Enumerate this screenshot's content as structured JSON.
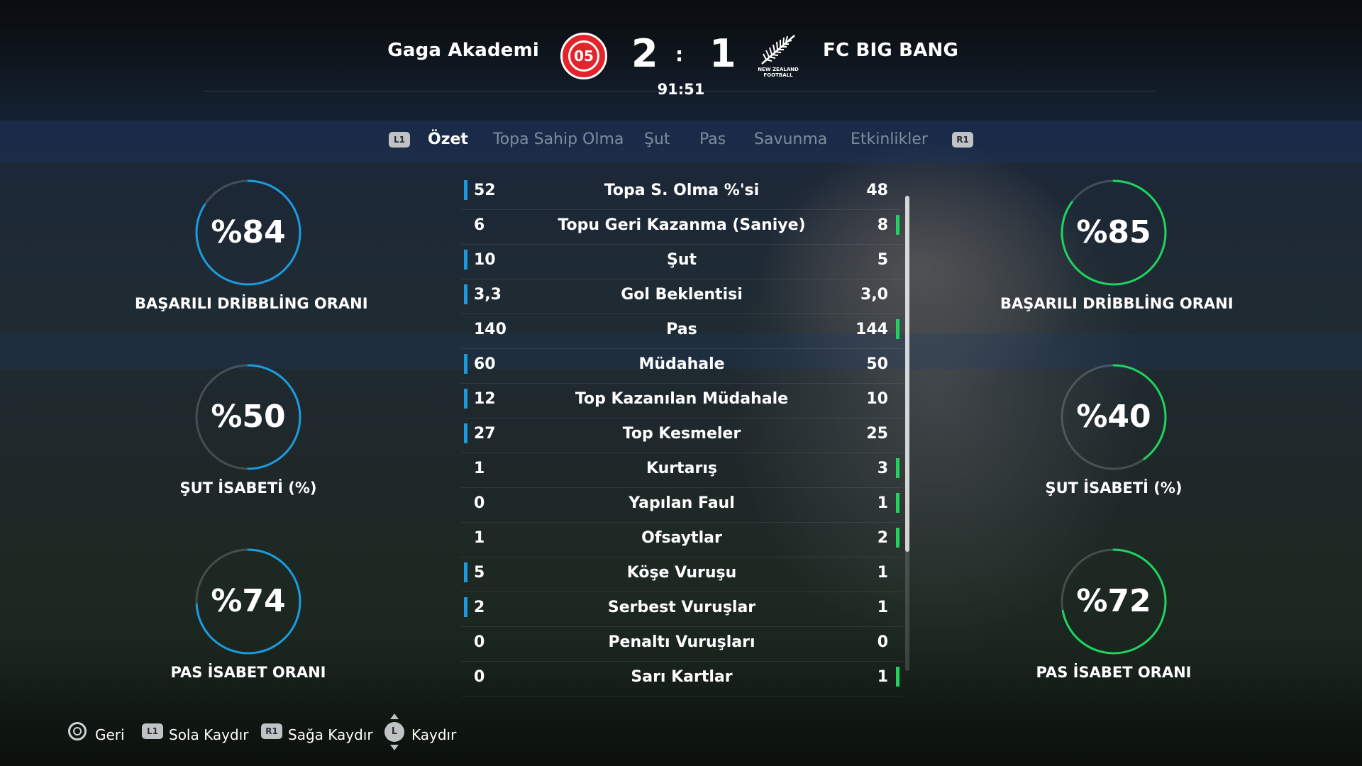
{
  "match": {
    "home_team": "Gaga Akademi",
    "away_team": "FC BIG BANG",
    "home_score": "2",
    "away_score": "1",
    "score_separator": ":",
    "clock": "91:51",
    "home_crest_text": "05",
    "away_crest_caption": "NEW ZEALAND FOOTBALL"
  },
  "tabs": {
    "left_button": "L1",
    "right_button": "R1",
    "items": [
      "Özet",
      "Topa Sahip Olma",
      "Şut",
      "Pas",
      "Savunma",
      "Etkinlikler"
    ],
    "active_index": 0
  },
  "home_rings": [
    {
      "value": "%84",
      "label": "BAŞARILI DRİBBLİNG ORANI",
      "fraction": 0.84
    },
    {
      "value": "%50",
      "label": "ŞUT İSABETİ (%)",
      "fraction": 0.5
    },
    {
      "value": "%74",
      "label": "PAS İSABET ORANI",
      "fraction": 0.74
    }
  ],
  "away_rings": [
    {
      "value": "%85",
      "label": "BAŞARILI DRİBBLİNG ORANI",
      "fraction": 0.85
    },
    {
      "value": "%40",
      "label": "ŞUT İSABETİ (%)",
      "fraction": 0.4
    },
    {
      "value": "%72",
      "label": "PAS İSABET ORANI",
      "fraction": 0.72
    }
  ],
  "stats": [
    {
      "label": "Topa S. Olma %'si",
      "home": "52",
      "away": "48",
      "leader": "home"
    },
    {
      "label": "Topu Geri Kazanma (Saniye)",
      "home": "6",
      "away": "8",
      "leader": "away"
    },
    {
      "label": "Şut",
      "home": "10",
      "away": "5",
      "leader": "home"
    },
    {
      "label": "Gol Beklentisi",
      "home": "3,3",
      "away": "3,0",
      "leader": "home"
    },
    {
      "label": "Pas",
      "home": "140",
      "away": "144",
      "leader": "away"
    },
    {
      "label": "Müdahale",
      "home": "60",
      "away": "50",
      "leader": "home"
    },
    {
      "label": "Top Kazanılan Müdahale",
      "home": "12",
      "away": "10",
      "leader": "home"
    },
    {
      "label": "Top Kesmeler",
      "home": "27",
      "away": "25",
      "leader": "home"
    },
    {
      "label": "Kurtarış",
      "home": "1",
      "away": "3",
      "leader": "away"
    },
    {
      "label": "Yapılan Faul",
      "home": "0",
      "away": "1",
      "leader": "away"
    },
    {
      "label": "Ofsaytlar",
      "home": "1",
      "away": "2",
      "leader": "away"
    },
    {
      "label": "Köşe Vuruşu",
      "home": "5",
      "away": "1",
      "leader": "home"
    },
    {
      "label": "Serbest Vuruşlar",
      "home": "2",
      "away": "1",
      "leader": "home"
    },
    {
      "label": "Penaltı Vuruşları",
      "home": "0",
      "away": "0",
      "leader": "none"
    },
    {
      "label": "Sarı Kartlar",
      "home": "0",
      "away": "1",
      "leader": "away"
    }
  ],
  "footer": {
    "back": "Geri",
    "scroll_left_button": "L1",
    "scroll_left": "Sola Kaydır",
    "scroll_right_button": "R1",
    "scroll_right": "Sağa Kaydır",
    "scroll_button": "L",
    "scroll": "Kaydır"
  },
  "colors": {
    "home": "#1a9be0",
    "away": "#1ed45d",
    "ring_track": "rgba(255,255,255,0.18)"
  }
}
